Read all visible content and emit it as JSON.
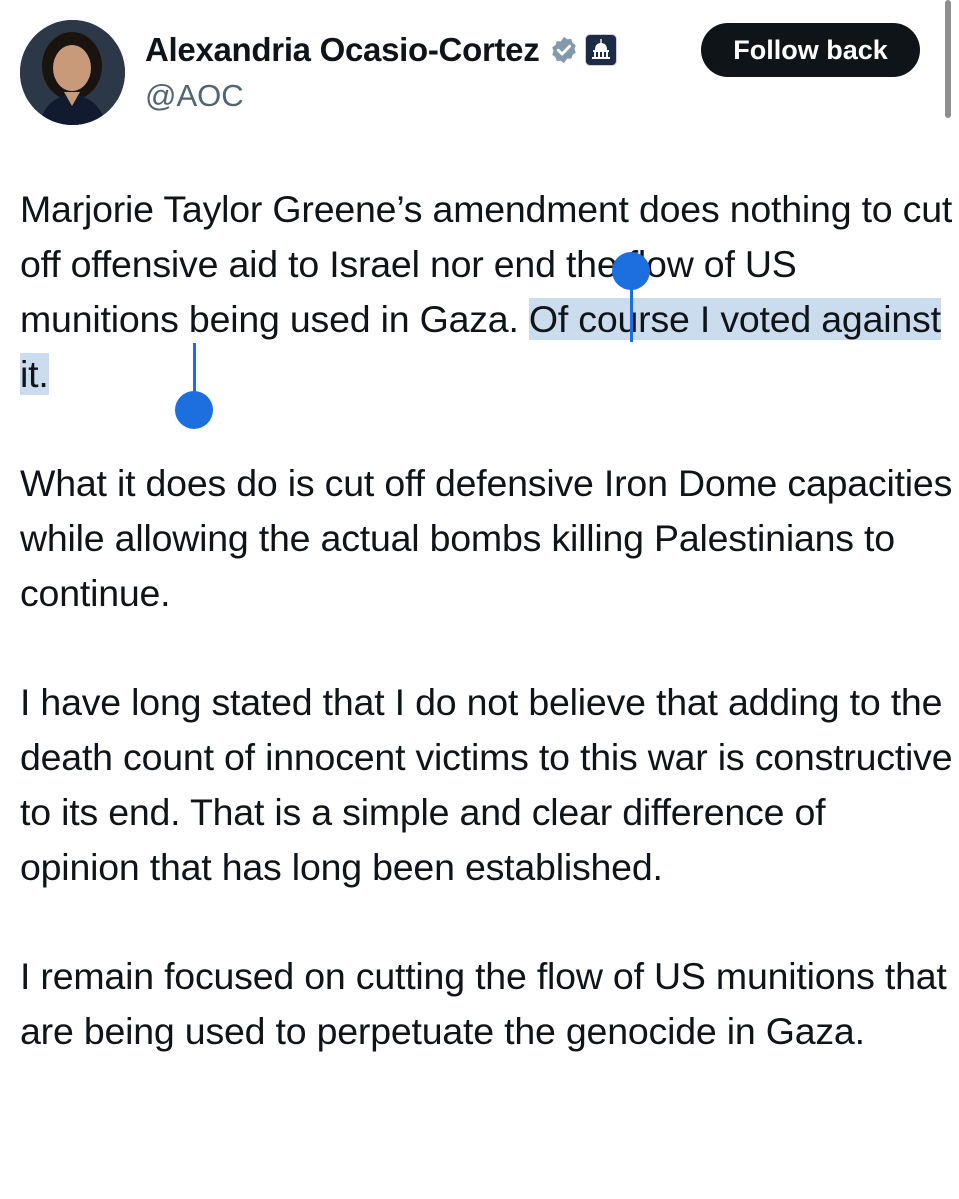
{
  "author": {
    "name": "Alexandria Ocasio-Cortez",
    "handle": "@AOC",
    "verified_icon": "verified-badge-icon",
    "affiliation_icon": "capitol-affiliation-icon"
  },
  "follow_button": {
    "label": "Follow back"
  },
  "tweet": {
    "p1_a": "Marjorie Taylor Greene’s amendment does nothing to cut off offensive aid to Israel nor end the flow of US munitions being used in Gaza. ",
    "p1_selected": "Of course I voted against it.",
    "p2": "What it does do is cut off defensive Iron Dome capacities while allowing the actual bombs killing Palestinians to continue.",
    "p3": "I have long stated that I do not believe that adding to the death count of innocent victims to this war is constructive to its end. That is a simple and clear difference of opinion that has long been established.",
    "p4": "I remain focused on cutting the flow of US munitions that are being used to perpetuate the genocide in Gaza."
  },
  "colors": {
    "selection_bg": "#cbdcee",
    "selection_handle": "#1d6fe0",
    "button_bg": "#0f1419",
    "handle_text": "#536471"
  }
}
